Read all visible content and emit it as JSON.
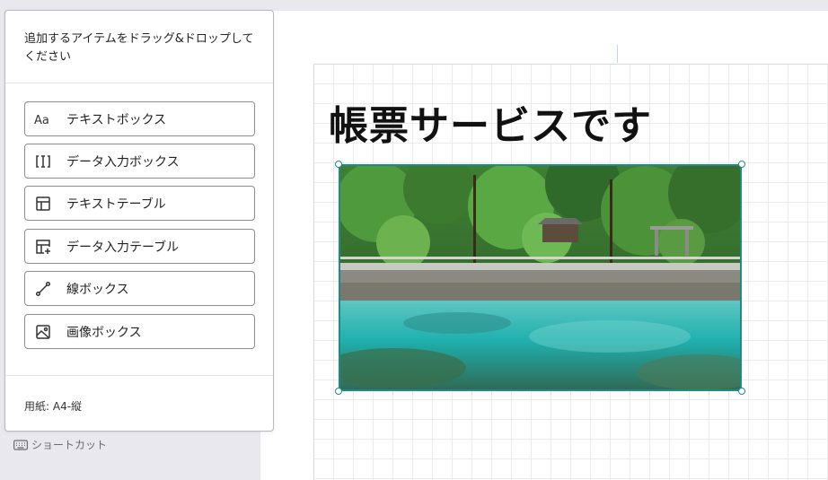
{
  "panel": {
    "instruction": "追加するアイテムをドラッグ&ドロップしてください",
    "items": [
      {
        "label": "テキストボックス",
        "icon": "text-font-icon"
      },
      {
        "label": "データ入力ボックス",
        "icon": "text-cursor-box-icon"
      },
      {
        "label": "テキストテーブル",
        "icon": "table-icon"
      },
      {
        "label": "データ入力テーブル",
        "icon": "table-add-icon"
      },
      {
        "label": "線ボックス",
        "icon": "line-icon"
      },
      {
        "label": "画像ボックス",
        "icon": "image-icon"
      }
    ],
    "paper_size": "用紙: A4-縦"
  },
  "shortcut": {
    "label": "ショートカット",
    "icon": "keyboard-icon"
  },
  "document": {
    "title": "帳票サービスです",
    "image_description_icon": "landscape-photo"
  },
  "colors": {
    "accent": "#1f8a86",
    "background": "#e8e8ee",
    "grid": "#ebebeb"
  }
}
